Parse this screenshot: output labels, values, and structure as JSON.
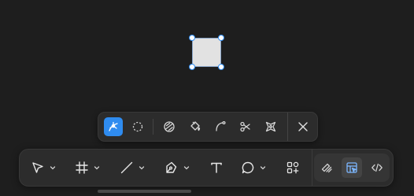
{
  "canvas": {
    "background": "#1e1e1e",
    "selected_shape": {
      "type": "rectangle",
      "fill": "#e2e2e2",
      "state": "selected"
    }
  },
  "edit_toolbar": {
    "tools": [
      {
        "icon": "bend-tool-icon",
        "active": true
      },
      {
        "icon": "lasso-icon",
        "active": false
      },
      {
        "icon": "boolean-icon",
        "active": false
      },
      {
        "icon": "paint-bucket-icon",
        "active": false
      },
      {
        "icon": "curve-icon",
        "active": false
      },
      {
        "icon": "cut-icon",
        "active": false
      },
      {
        "icon": "shape-builder-icon",
        "active": false
      },
      {
        "icon": "close-icon",
        "active": false
      }
    ],
    "accent": "#2f8cf0"
  },
  "main_toolbar": {
    "tools": [
      {
        "icon": "move-cursor-icon",
        "has_dropdown": true
      },
      {
        "icon": "frame-icon",
        "has_dropdown": true
      },
      {
        "icon": "line-icon",
        "has_dropdown": true
      },
      {
        "icon": "pen-icon",
        "has_dropdown": true
      },
      {
        "icon": "text-icon",
        "has_dropdown": false
      },
      {
        "icon": "comment-icon",
        "has_dropdown": true
      },
      {
        "icon": "actions-icon",
        "has_dropdown": false
      }
    ],
    "modes": [
      {
        "icon": "draw-mode-icon",
        "selected": false
      },
      {
        "icon": "design-mode-icon",
        "selected": true,
        "color": "#7cb7ff"
      },
      {
        "icon": "dev-mode-icon",
        "selected": false
      }
    ]
  }
}
